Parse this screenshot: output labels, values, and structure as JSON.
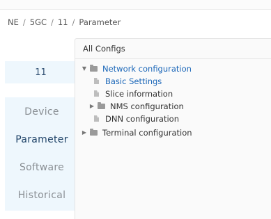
{
  "breadcrumb": [
    "NE",
    "5GC",
    "11",
    "Parameter"
  ],
  "node": {
    "label": "11"
  },
  "menu": [
    {
      "label": "Device",
      "active": false
    },
    {
      "label": "Parameter",
      "active": true
    },
    {
      "label": "Software",
      "active": false
    },
    {
      "label": "Historical",
      "active": false
    }
  ],
  "panel": {
    "title": "All Configs",
    "tree": [
      {
        "label": "Network configuration",
        "type": "folder",
        "expanded": true,
        "highlight": true
      },
      {
        "label": "Basic Settings",
        "type": "doc",
        "selected": true
      },
      {
        "label": "Slice information",
        "type": "doc"
      },
      {
        "label": "NMS configuration",
        "type": "folder",
        "expanded": false
      },
      {
        "label": "DNN configuration",
        "type": "doc"
      },
      {
        "label": "Terminal configuration",
        "type": "folder",
        "expanded": false
      }
    ]
  }
}
